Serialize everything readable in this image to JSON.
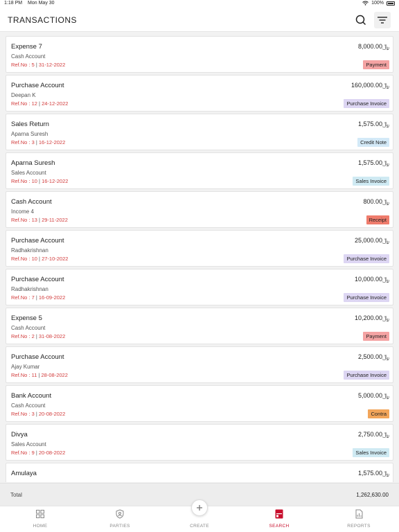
{
  "status_bar": {
    "time": "1:18 PM",
    "date": "Mon May 30",
    "battery": "100%"
  },
  "header": {
    "title": "TRANSACTIONS",
    "search_icon": "search-icon",
    "filter_icon": "filter-icon"
  },
  "colors": {
    "accent": "#c8102e",
    "ref_text": "#d23b3b"
  },
  "transactions": [
    {
      "title": "Expense 7",
      "subtitle": "Cash Account",
      "ref": "Ref.No : 5",
      "date": "31-12-2022",
      "amount": "8,000.00",
      "currency": "﷼",
      "type": "Payment",
      "badge_color": "#f4a3a3"
    },
    {
      "title": "Purchase Account",
      "subtitle": "Deepan K",
      "ref": "Ref.No : 12",
      "date": "24-12-2022",
      "amount": "160,000.00",
      "currency": "﷼",
      "type": "Purchase Invoice",
      "badge_color": "#ddd6f3"
    },
    {
      "title": "Sales Return",
      "subtitle": "Aparna Suresh",
      "ref": "Ref.No : 3",
      "date": "16-12-2022",
      "amount": "1,575.00",
      "currency": "﷼",
      "type": "Credit Note",
      "badge_color": "#d3e9f7"
    },
    {
      "title": "Aparna Suresh",
      "subtitle": "Sales Account",
      "ref": "Ref.No : 10",
      "date": "16-12-2022",
      "amount": "1,575.00",
      "currency": "﷼",
      "type": "Sales Invoice",
      "badge_color": "#cfeaf3"
    },
    {
      "title": "Cash Account",
      "subtitle": "Income 4",
      "ref": "Ref.No : 13",
      "date": "29-11-2022",
      "amount": "800.00",
      "currency": "﷼",
      "type": "Receipt",
      "badge_color": "#ef7c6c"
    },
    {
      "title": "Purchase Account",
      "subtitle": "Radhakrishnan",
      "ref": "Ref.No : 10",
      "date": "27-10-2022",
      "amount": "25,000.00",
      "currency": "﷼",
      "type": "Purchase Invoice",
      "badge_color": "#ddd6f3"
    },
    {
      "title": "Purchase Account",
      "subtitle": "Radhakrishnan",
      "ref": "Ref.No : 7",
      "date": "16-09-2022",
      "amount": "10,000.00",
      "currency": "﷼",
      "type": "Purchase Invoice",
      "badge_color": "#ddd6f3"
    },
    {
      "title": "Expense 5",
      "subtitle": "Cash Account",
      "ref": "Ref.No : 2",
      "date": "31-08-2022",
      "amount": "10,200.00",
      "currency": "﷼",
      "type": "Payment",
      "badge_color": "#f4a3a3"
    },
    {
      "title": "Purchase Account",
      "subtitle": "Ajay Kumar",
      "ref": "Ref.No : 11",
      "date": "28-08-2022",
      "amount": "2,500.00",
      "currency": "﷼",
      "type": "Purchase Invoice",
      "badge_color": "#ddd6f3"
    },
    {
      "title": "Bank Account",
      "subtitle": "Cash Account",
      "ref": "Ref.No : 3",
      "date": "20-08-2022",
      "amount": "5,000.00",
      "currency": "﷼",
      "type": "Contra",
      "badge_color": "#f2a55a"
    },
    {
      "title": "Divya",
      "subtitle": "Sales Account",
      "ref": "Ref.No : 9",
      "date": "20-08-2022",
      "amount": "2,750.00",
      "currency": "﷼",
      "type": "Sales Invoice",
      "badge_color": "#cfeaf3"
    },
    {
      "title": "Amulaya",
      "subtitle": "",
      "ref": "",
      "date": "",
      "amount": "1,575.00",
      "currency": "﷼",
      "type": "",
      "badge_color": ""
    }
  ],
  "total": {
    "label": "Total",
    "value": "1,262,630.00"
  },
  "tabs": [
    {
      "label": "HOME",
      "icon": "home-grid-icon",
      "active": false
    },
    {
      "label": "PARTIES",
      "icon": "parties-shield-icon",
      "active": false
    },
    {
      "label": "CREATE",
      "icon": "plus-icon",
      "active": false
    },
    {
      "label": "SEARCH",
      "icon": "search-tab-icon",
      "active": true
    },
    {
      "label": "REPORTS",
      "icon": "reports-icon",
      "active": false
    }
  ]
}
